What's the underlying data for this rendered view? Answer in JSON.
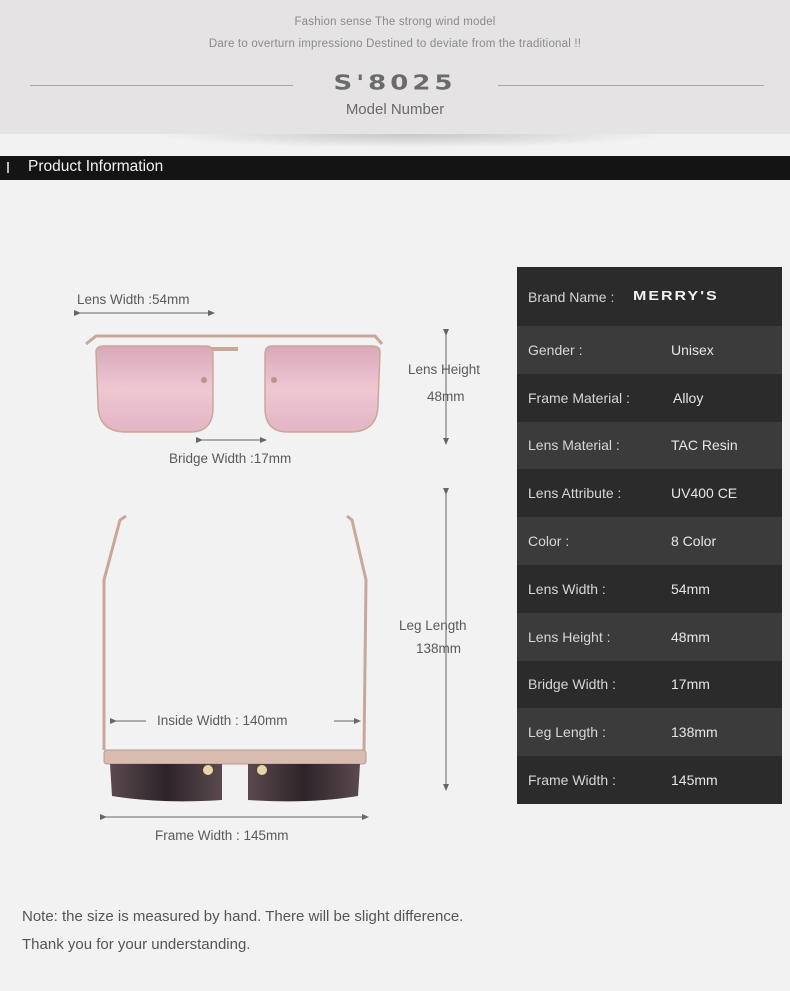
{
  "header": {
    "tagline1": "Fashion sense The strong wind model",
    "tagline2": "Dare to overturn impressiono Destined to deviate from the traditional !!",
    "model_code": "S'8025",
    "model_label": "Model Number"
  },
  "section_bar": {
    "title": "Product Information"
  },
  "diagram": {
    "lens_width": "Lens Width :54mm",
    "lens_height_title": "Lens Height",
    "lens_height_value": "48mm",
    "bridge_width": "Bridge Width :17mm",
    "leg_length_title": "Leg Length",
    "leg_length_value": "138mm",
    "inside_width": "Inside  Width : 140mm",
    "frame_width": "Frame Width : 145mm"
  },
  "specs": {
    "brand_key": "Brand Name :",
    "brand_value": "MERRY'S",
    "rows": [
      {
        "key": "Gender :",
        "value": "Unisex"
      },
      {
        "key": "Frame Material :",
        "value": "Alloy"
      },
      {
        "key": "Lens Material :",
        "value": "TAC Resin"
      },
      {
        "key": "Lens Attribute :",
        "value": "UV400 CE"
      },
      {
        "key": "Color :",
        "value": "8 Color"
      },
      {
        "key": "Lens Width :",
        "value": "54mm"
      },
      {
        "key": "Lens Height :",
        "value": "48mm"
      },
      {
        "key": "Bridge Width :",
        "value": "17mm"
      },
      {
        "key": "Leg Length :",
        "value": "138mm"
      },
      {
        "key": "Frame Width :",
        "value": "145mm"
      }
    ]
  },
  "note": {
    "line1": "Note: the size is measured by hand. There will be slight difference.",
    "line2": "Thank you for your understanding."
  },
  "colors": {
    "lens_pink": "#e8b7c6",
    "frame_gold": "#c9a89a",
    "table_dark": "#2b2b2b",
    "table_mid": "#3b3b3b"
  }
}
